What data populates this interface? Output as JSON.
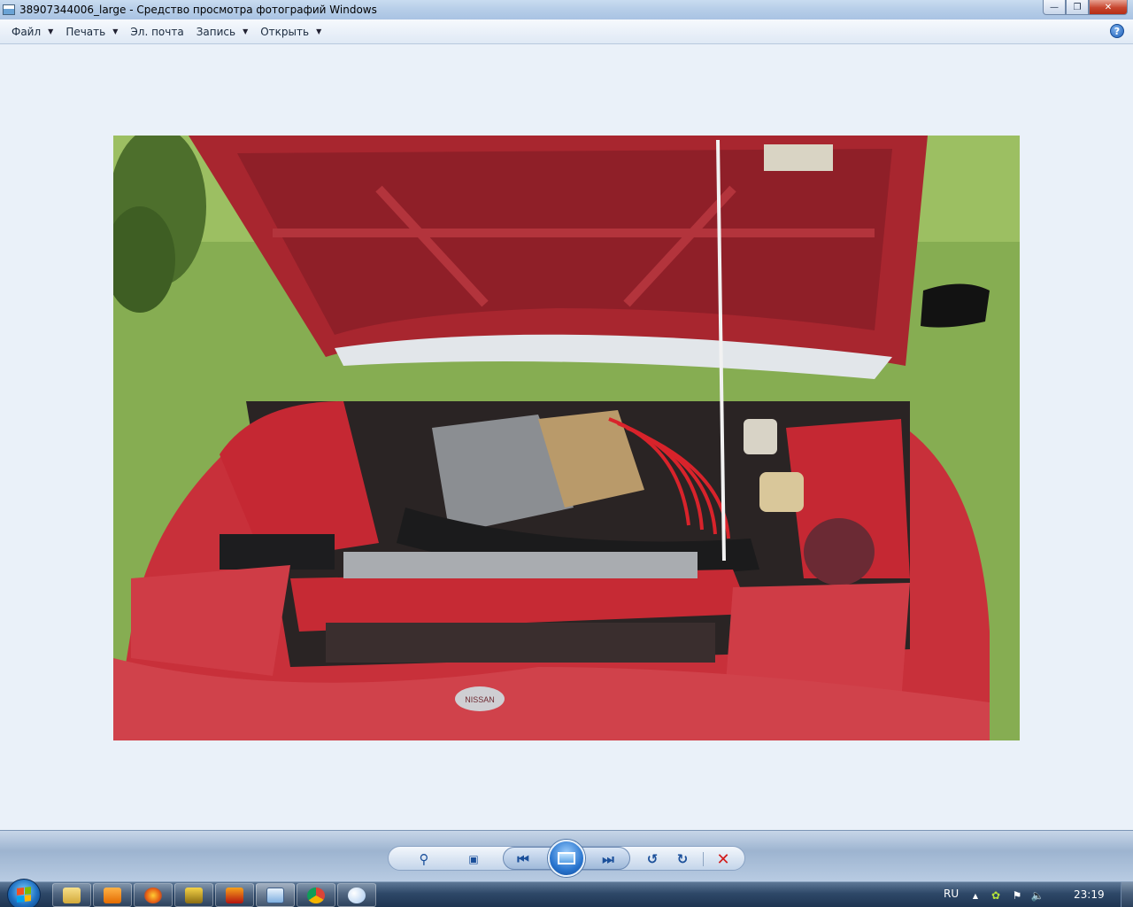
{
  "window": {
    "title": "38907344006_large - Средство просмотра фотографий Windows",
    "minimize_icon": "minimize-icon",
    "maximize_icon": "restore-icon",
    "close_icon": "close-icon"
  },
  "menu": {
    "items": [
      {
        "label": "Файл",
        "has_dropdown": true
      },
      {
        "label": "Печать",
        "has_dropdown": true
      },
      {
        "label": "Эл. почта",
        "has_dropdown": false
      },
      {
        "label": "Запись",
        "has_dropdown": true
      },
      {
        "label": "Открыть",
        "has_dropdown": true
      }
    ],
    "help_label": "?"
  },
  "photo": {
    "description_icon": "car-engine-bay-photo",
    "badge_text": "NISSAN"
  },
  "controls": {
    "zoom_icon": "zoom-icon",
    "actual_size_icon": "actual-size-icon",
    "previous_icon": "previous-icon",
    "slideshow_icon": "slideshow-icon",
    "next_icon": "next-icon",
    "rotate_ccw_icon": "rotate-counterclockwise-icon",
    "rotate_cw_icon": "rotate-clockwise-icon",
    "delete_icon": "delete-icon"
  },
  "taskbar": {
    "apps": [
      "explorer",
      "media-player",
      "firefox",
      "winamp",
      "filezilla",
      "photo-viewer",
      "chrome",
      "paint"
    ],
    "language": "RU",
    "clock": "23:19",
    "colors": {
      "taskbar": "#2e4868",
      "accent": "#1e6fc0"
    }
  }
}
